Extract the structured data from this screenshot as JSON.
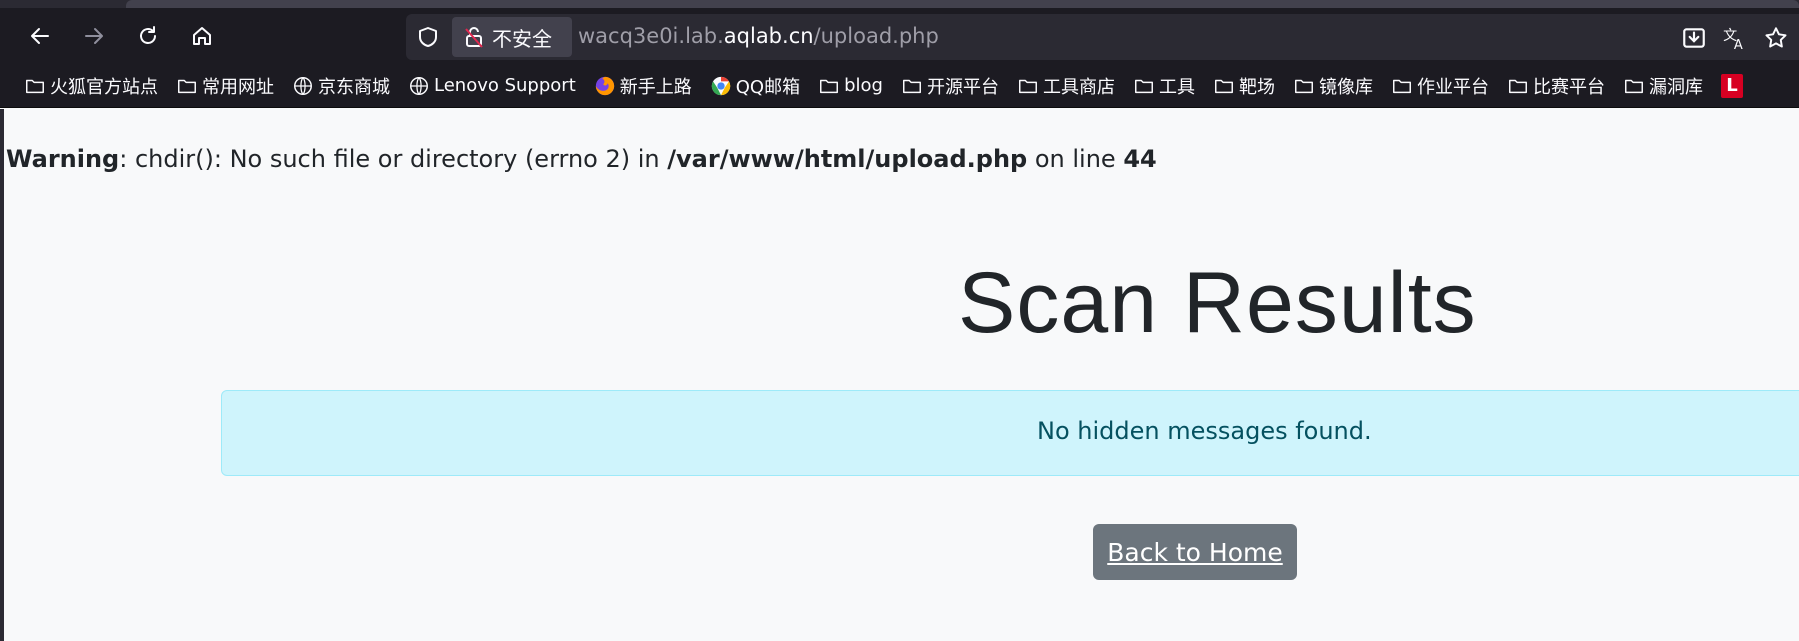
{
  "browser": {
    "security_label": "不安全",
    "url_prefix": "wacq3e0i.lab.",
    "url_host": "aqlab.cn",
    "url_path": "/upload.php"
  },
  "bookmarks": [
    {
      "label": "火狐官方站点",
      "icon": "folder-icon"
    },
    {
      "label": "常用网址",
      "icon": "folder-icon"
    },
    {
      "label": "京东商城",
      "icon": "globe-icon"
    },
    {
      "label": "Lenovo Support",
      "icon": "globe-icon"
    },
    {
      "label": "新手上路",
      "icon": "firefox-icon"
    },
    {
      "label": "QQ邮箱",
      "icon": "qqmail-icon"
    },
    {
      "label": "blog",
      "icon": "folder-icon"
    },
    {
      "label": "开源平台",
      "icon": "folder-icon"
    },
    {
      "label": "工具商店",
      "icon": "folder-icon"
    },
    {
      "label": "工具",
      "icon": "folder-icon"
    },
    {
      "label": "靶场",
      "icon": "folder-icon"
    },
    {
      "label": "镜像库",
      "icon": "folder-icon"
    },
    {
      "label": "作业平台",
      "icon": "folder-icon"
    },
    {
      "label": "比赛平台",
      "icon": "folder-icon"
    },
    {
      "label": "漏洞库",
      "icon": "folder-icon"
    }
  ],
  "bookmark_overflow_label": "L",
  "warning": {
    "label": "Warning",
    "message": ": chdir(): No such file or directory (errno 2) in ",
    "path": "/var/www/html/upload.php",
    "on_line": " on line ",
    "line": "44"
  },
  "page": {
    "title": "Scan Results",
    "alert_message": "No hidden messages found.",
    "back_button": "Back to Home"
  },
  "colors": {
    "alert_bg": "#cff4fc",
    "alert_text": "#055160",
    "button_bg": "#6c757d"
  }
}
